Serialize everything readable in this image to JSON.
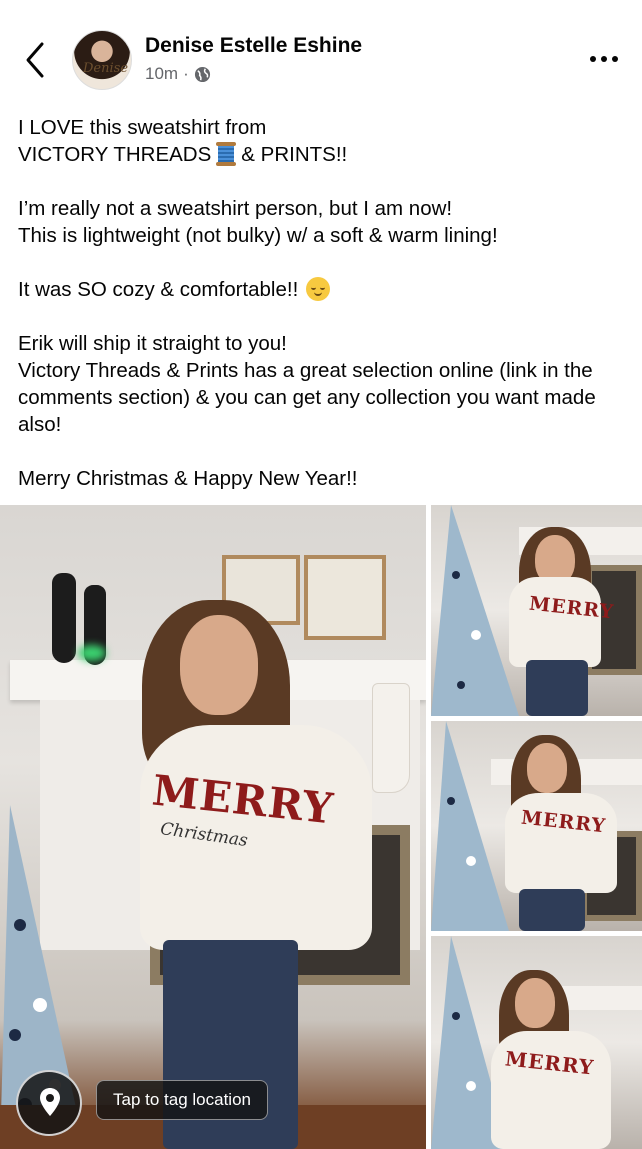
{
  "header": {
    "author_name": "Denise Estelle Eshine",
    "timestamp": "10m",
    "separator": "·",
    "privacy_icon": "globe-icon",
    "back_icon": "chevron-left-icon",
    "more_icon": "more-dots-icon",
    "avatar_signature": "Denise"
  },
  "post": {
    "line1": "I LOVE this sweatshirt from",
    "line2a": "VICTORY THREADS",
    "line2_emoji": "spool-of-thread-emoji",
    "line2b": "& PRINTS!!",
    "para2": "I’m really not a sweatshirt person, but I am now!\nThis is lightweight (not bulky) w/ a soft & warm lining!",
    "para3": "It was SO cozy & comfortable!!",
    "para3_emoji": "relieved-face-emoji",
    "para4": "Erik will ship it straight to you!\nVictory Threads & Prints has a great selection online (link in the comments section) & you can get any collection you want made also!",
    "para5": "Merry Christmas & Happy New Year!!"
  },
  "photos": {
    "count": 4,
    "shirt_text_main": "MERRY",
    "shirt_text_script": "Christmas"
  },
  "location": {
    "pin_icon": "location-pin-icon",
    "tag_label": "Tap to tag location"
  },
  "colors": {
    "text_primary": "#050505",
    "text_secondary": "#65676b",
    "shirt_print": "#8e1b1b"
  }
}
